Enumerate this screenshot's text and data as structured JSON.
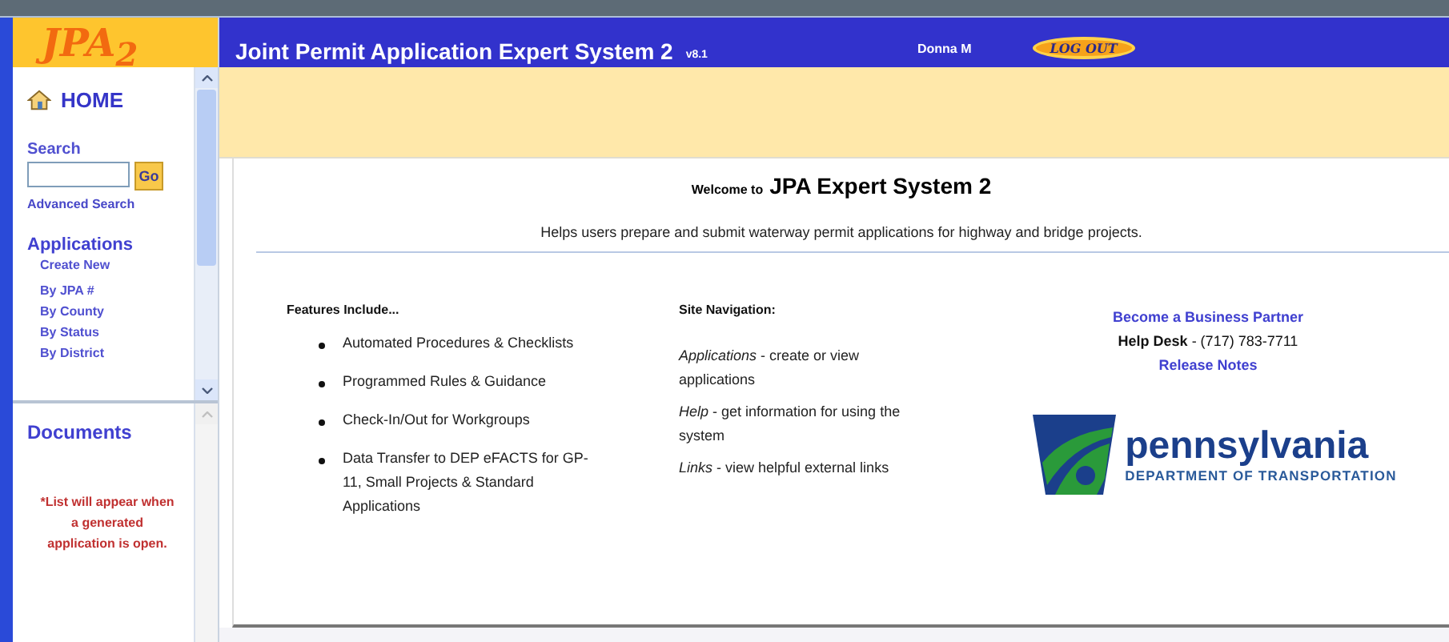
{
  "logo": "JPA$_{2}$",
  "header": {
    "title": "Joint Permit Application Expert System 2",
    "version": "v8.1",
    "user": "Donna M",
    "logout": "LOG OUT"
  },
  "sidebar": {
    "home": "HOME",
    "search": {
      "label": "Search",
      "button": "Go",
      "advanced": "Advanced Search"
    },
    "applications": {
      "heading": "Applications",
      "create": "Create New",
      "items": [
        "By JPA #",
        "By County",
        "By Status",
        "By District"
      ]
    },
    "documents": {
      "heading": "Documents",
      "notice": "*List will appear when a generated application is open."
    }
  },
  "welcome": {
    "prefix": "Welcome to",
    "name": "JPA Expert System 2",
    "subtitle": "Helps users prepare and submit waterway permit applications for highway and bridge projects."
  },
  "features": {
    "heading": "Features Include...",
    "items": [
      "Automated Procedures & Checklists",
      "Programmed Rules & Guidance",
      "Check-In/Out for Workgroups",
      "Data Transfer to DEP eFACTS for GP-11, Small Projects & Standard Applications"
    ]
  },
  "site_navigation": {
    "heading": "Site Navigation:",
    "items": [
      "*Applications* - create or view applications",
      "*Help* - get information for using the system",
      "*Links* - view helpful external links"
    ]
  },
  "links": {
    "partner": "Become a Business Partner",
    "help_desk": "**Help Desk** -  (717) 783-7711",
    "release_notes": "Release Notes"
  },
  "agency_logo": {
    "name": "pennsylvania",
    "subtitle": "DEPARTMENT OF TRANSPORTATION"
  }
}
